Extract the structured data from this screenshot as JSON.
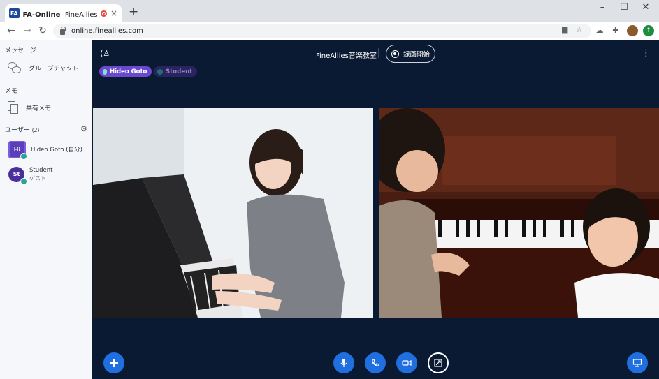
{
  "browser": {
    "tab_favicon": "FA",
    "tab_title_bold": "FA-Online",
    "tab_title_rest": "FineAllies音楽教",
    "tab_close": "×",
    "new_tab": "+",
    "url": "online.fineallies.com",
    "window_controls": {
      "minimize": "–",
      "maximize": "☐",
      "close": "✕"
    }
  },
  "sidebar": {
    "messages_header": "メッセージ",
    "group_chat": "グループチャット",
    "memo_header": "メモ",
    "shared_memo": "共有メモ",
    "users_header": "ユーザー",
    "users_count": "(2)",
    "users": [
      {
        "initials": "Hi",
        "name": "Hideo Goto (自分)",
        "sub": ""
      },
      {
        "initials": "St",
        "name": "Student",
        "sub": "ゲスト"
      }
    ]
  },
  "main": {
    "room_title": "FineAllies音楽教室",
    "record_label": "録画開始",
    "participants": [
      {
        "name": "Hideo Goto",
        "active": true
      },
      {
        "name": "Student",
        "active": false
      }
    ]
  },
  "colors": {
    "main_bg": "#0b1a33",
    "accent_blue": "#1f6fe0",
    "pill_active": "#6a48cf",
    "pill_inactive": "#2a2362",
    "sidebar_bg": "#f6f7fb"
  },
  "icons": [
    "layout-icon",
    "kebab-menu-icon",
    "mic-icon",
    "phone-icon",
    "camera-icon",
    "screen-share-icon",
    "add-icon",
    "present-icon",
    "gear-icon",
    "chat-icon",
    "memo-icon"
  ]
}
